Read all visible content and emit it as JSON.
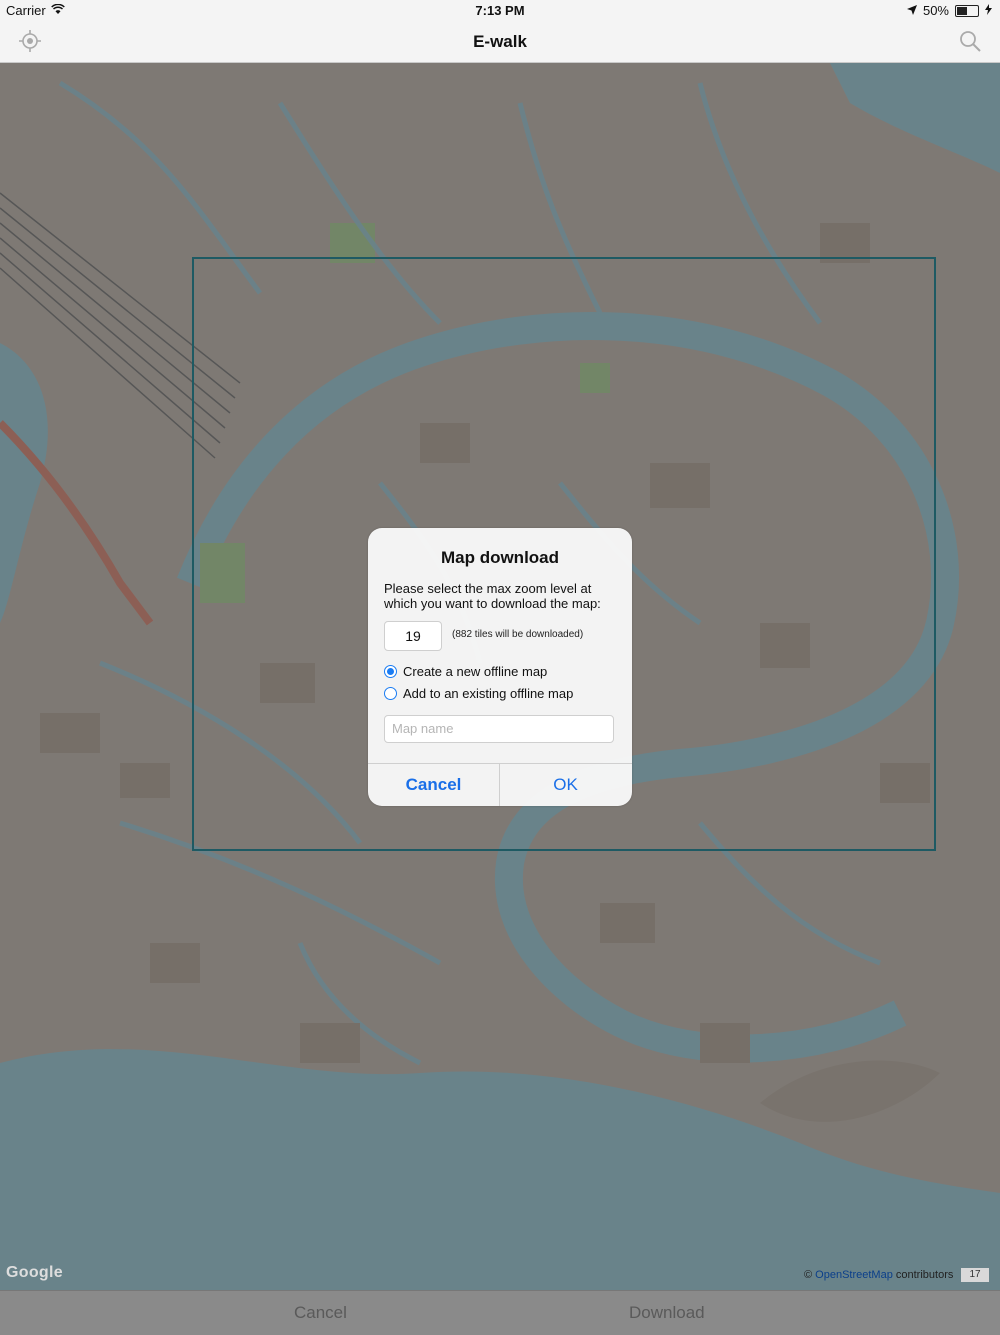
{
  "status_bar": {
    "carrier": "Carrier",
    "time": "7:13 PM",
    "battery": "50%"
  },
  "nav": {
    "title": "E-walk"
  },
  "dialog": {
    "title": "Map download",
    "message": "Please select the max zoom level at which you want to download the map:",
    "zoom_value": "19",
    "tiles_note": "(882 tiles will be downloaded)",
    "options": [
      {
        "label": "Create a new offline map",
        "selected": true
      },
      {
        "label": "Add to an existing offline map",
        "selected": false
      }
    ],
    "name_placeholder": "Map name",
    "cancel_label": "Cancel",
    "ok_label": "OK"
  },
  "map": {
    "brand": "Google",
    "attribution_prefix": "©",
    "attribution_link": "OpenStreetMap",
    "attribution_suffix": "contributors",
    "zoom_level": "17",
    "colors": {
      "land": "#ccc4bc",
      "water": "#aad3df",
      "frame": "#1e5a63"
    }
  },
  "toolbar": {
    "cancel_label": "Cancel",
    "download_label": "Download"
  },
  "colors": {
    "accent": "#1a6fe8"
  }
}
